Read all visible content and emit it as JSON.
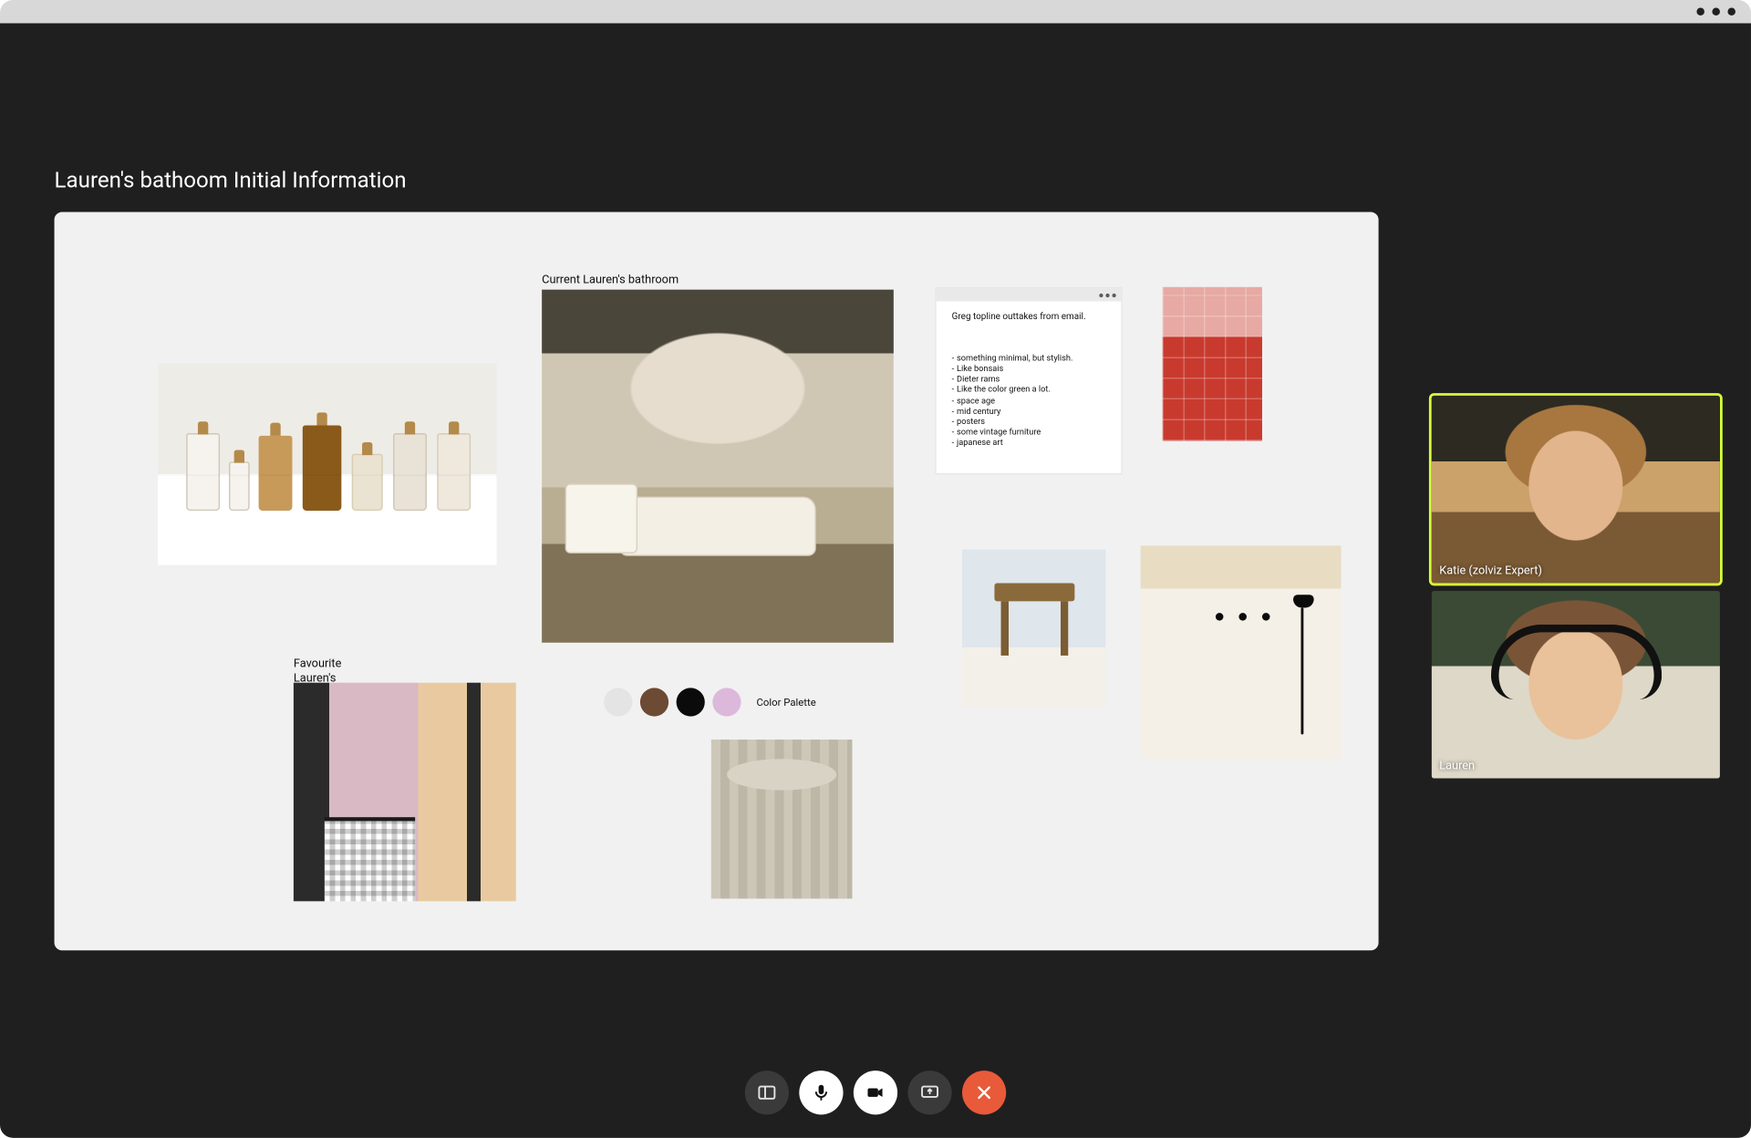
{
  "page_title": "Lauren's bathoom Initial Information",
  "moodboard": {
    "current_caption": "Current Lauren's bathroom",
    "fav_caption_line1": "Favourite",
    "fav_caption_line2": "Lauren's Style",
    "palette": {
      "label": "Color Palette",
      "swatches": [
        "#e4e4e4",
        "#6d4a33",
        "#0b0b0b",
        "#dcb8db"
      ]
    },
    "note": {
      "title": "Greg topline outtakes from email.",
      "items": [
        "something minimal, but stylish.",
        "Like bonsais",
        "Dieter rams",
        "Like  the color green a lot.",
        "space age",
        "mid century",
        "posters",
        "some vintage furniture",
        "japanese art"
      ]
    }
  },
  "participants": [
    {
      "name": "Katie (zolviz Expert)",
      "active": true
    },
    {
      "name": "Lauren",
      "active": false
    }
  ],
  "controls": {
    "layout": "layout-toggle",
    "mic": "microphone",
    "camera": "camera",
    "screenshare": "screen-share",
    "end": "end-call"
  }
}
